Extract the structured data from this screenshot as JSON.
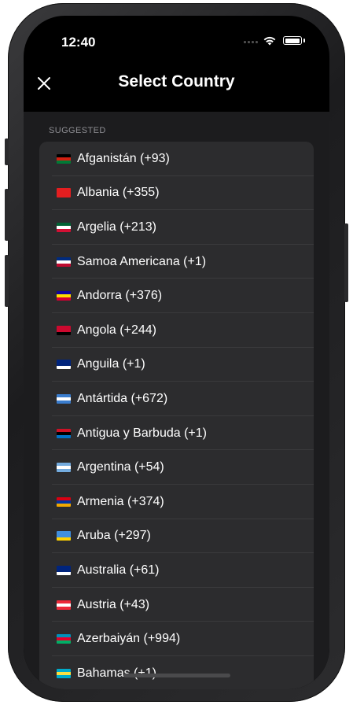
{
  "status": {
    "time": "12:40"
  },
  "header": {
    "title": "Select Country"
  },
  "section": {
    "label": "SUGGESTED"
  },
  "countries": [
    {
      "label": "Afganistán (+93)",
      "flag": [
        "#000000",
        "#d32011",
        "#007a36"
      ]
    },
    {
      "label": "Albania (+355)",
      "flag": [
        "#e41e20",
        "#e41e20",
        "#e41e20"
      ]
    },
    {
      "label": "Argelia (+213)",
      "flag": [
        "#006233",
        "#ffffff",
        "#d21034"
      ]
    },
    {
      "label": "Samoa Americana (+1)",
      "flag": [
        "#002b7f",
        "#ffffff",
        "#bf0a30"
      ]
    },
    {
      "label": "Andorra (+376)",
      "flag": [
        "#10069f",
        "#fedf00",
        "#d50032"
      ]
    },
    {
      "label": "Angola (+244)",
      "flag": [
        "#cc092f",
        "#cc092f",
        "#000000"
      ]
    },
    {
      "label": "Anguila (+1)",
      "flag": [
        "#00247d",
        "#00247d",
        "#ffffff"
      ]
    },
    {
      "label": "Antártida (+672)",
      "flag": [
        "#3a7dce",
        "#ffffff",
        "#3a7dce"
      ]
    },
    {
      "label": "Antigua y Barbuda (+1)",
      "flag": [
        "#ce1126",
        "#000000",
        "#0072c6"
      ]
    },
    {
      "label": "Argentina (+54)",
      "flag": [
        "#74acdf",
        "#ffffff",
        "#74acdf"
      ]
    },
    {
      "label": "Armenia (+374)",
      "flag": [
        "#d90012",
        "#0033a0",
        "#f2a800"
      ]
    },
    {
      "label": "Aruba (+297)",
      "flag": [
        "#418fde",
        "#418fde",
        "#ffd100"
      ]
    },
    {
      "label": "Australia (+61)",
      "flag": [
        "#00247d",
        "#00247d",
        "#ffffff"
      ]
    },
    {
      "label": "Austria (+43)",
      "flag": [
        "#ed2939",
        "#ffffff",
        "#ed2939"
      ]
    },
    {
      "label": "Azerbaiyán (+994)",
      "flag": [
        "#0092bc",
        "#e4002b",
        "#00af66"
      ]
    },
    {
      "label": "Bahamas (+1)",
      "flag": [
        "#00abc9",
        "#fae042",
        "#00abc9"
      ]
    }
  ]
}
